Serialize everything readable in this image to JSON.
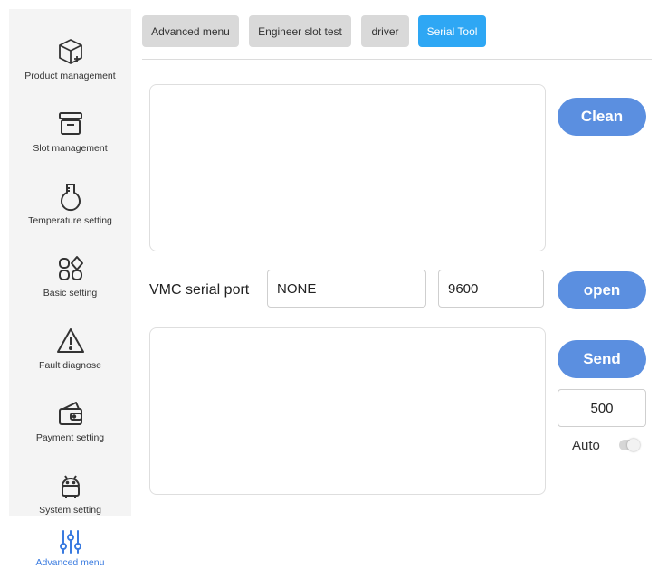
{
  "sidebar": {
    "items": [
      {
        "label": "Product management",
        "icon": "box-add-icon"
      },
      {
        "label": "Slot management",
        "icon": "archive-icon"
      },
      {
        "label": "Temperature setting",
        "icon": "flask-icon"
      },
      {
        "label": "Basic setting",
        "icon": "apps-icon"
      },
      {
        "label": "Fault diagnose",
        "icon": "warning-icon"
      },
      {
        "label": "Payment setting",
        "icon": "wallet-icon"
      },
      {
        "label": "System setting",
        "icon": "android-icon"
      }
    ],
    "active": {
      "label": "Advanced menu",
      "icon": "sliders-icon"
    }
  },
  "tabs": [
    {
      "label": "Advanced menu"
    },
    {
      "label": "Engineer slot test"
    },
    {
      "label": "driver"
    },
    {
      "label": "Serial Tool"
    }
  ],
  "serial": {
    "clean_label": "Clean",
    "port_label": "VMC serial port",
    "port_value": "NONE",
    "baud_value": "9600",
    "open_label": "open",
    "send_label": "Send",
    "interval_value": "500",
    "auto_label": "Auto",
    "auto_enabled": false
  },
  "colors": {
    "accent_button": "#5b8fe0",
    "active_tab": "#2ea7f4",
    "active_sidebar": "#3a7be0"
  }
}
